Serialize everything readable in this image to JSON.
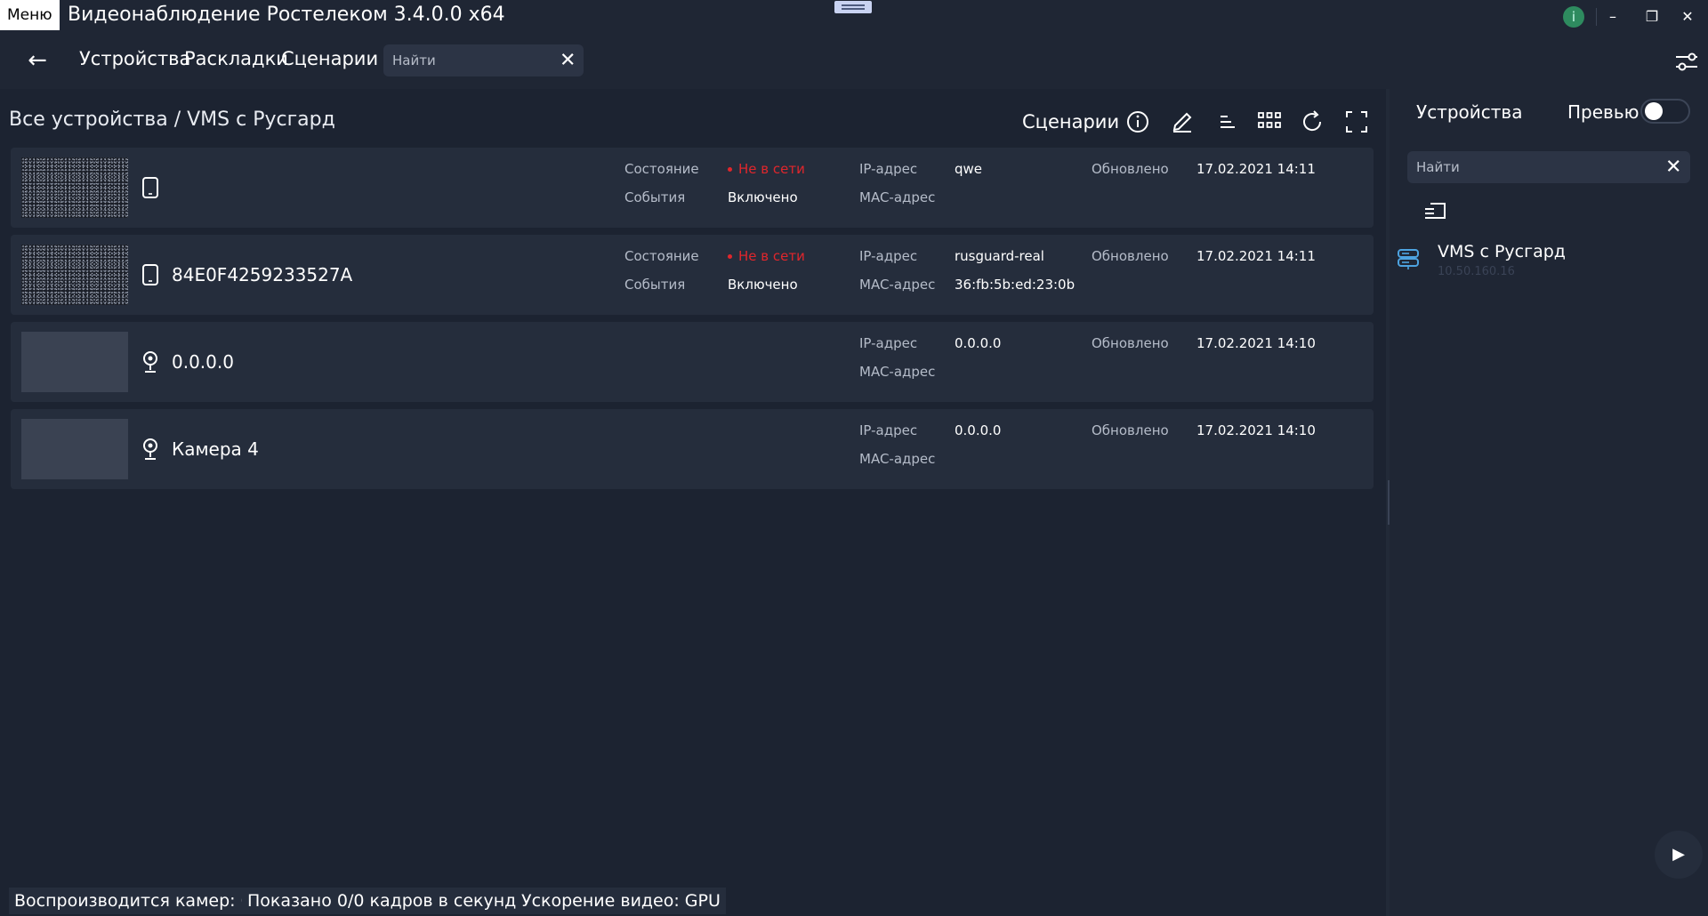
{
  "titlebar": {
    "menu_label": "Меню",
    "app_title": "Видеонаблюдение Ростелеком 3.4.0.0 x64",
    "info_glyph": "i",
    "minimize_glyph": "–",
    "restore_glyph": "❐",
    "close_glyph": "✕"
  },
  "nav": {
    "back_glyph": "←",
    "tabs": [
      "Устройства",
      "Раскладки",
      "Сценарии"
    ],
    "search_placeholder": "Найти",
    "clear_glyph": "✕"
  },
  "main": {
    "breadcrumb": "Все устройства / VMS с Русгард",
    "toolbar_scenarios": "Сценарии",
    "toolbar_icons": [
      "info-icon",
      "edit-icon",
      "sort-icon",
      "grid-icon",
      "refresh-icon",
      "fullscreen-icon"
    ]
  },
  "labels": {
    "state": "Состояние",
    "events": "События",
    "ip": "IP-адрес",
    "mac": "MAC-адрес",
    "updated": "Обновлено"
  },
  "devices": [
    {
      "name": "",
      "icon": "tablet-icon",
      "state": "Не в сети",
      "events": "Включено",
      "ip": "qwe",
      "mac": "",
      "updated": "17.02.2021 14:11"
    },
    {
      "name": "84E0F4259233527A",
      "icon": "tablet-icon",
      "state": "Не в сети",
      "events": "Включено",
      "ip": "rusguard-real",
      "mac": "36:fb:5b:ed:23:0b",
      "updated": "17.02.2021 14:11"
    },
    {
      "name": "0.0.0.0",
      "icon": "webcam-icon",
      "ip": "0.0.0.0",
      "mac": "",
      "updated": "17.02.2021 14:10"
    },
    {
      "name": "Камера 4",
      "icon": "webcam-icon",
      "ip": "0.0.0.0",
      "mac": "",
      "updated": "17.02.2021 14:10"
    }
  ],
  "right_panel": {
    "title": "Устройства",
    "preview_label": "Превью",
    "preview_enabled": false,
    "search_placeholder": "Найти",
    "clear_glyph": "✕",
    "item_name": "VMS с Русгард",
    "item_sub": "10.50.160.16",
    "play_glyph": "▶"
  },
  "statusbar": {
    "cameras": "Воспроизводится камер: 0",
    "fps": "Показано 0/0 кадров в секунду",
    "accel": "Ускорение видео: GPU"
  },
  "colors": {
    "background": "#1c2331",
    "row": "#252d3c",
    "offline_red": "#e0262c",
    "info_green": "#2e8b5f"
  }
}
